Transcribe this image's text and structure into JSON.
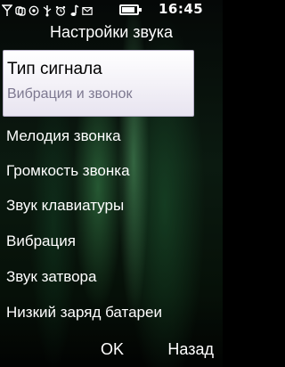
{
  "status_bar": {
    "icons": [
      "signal-icon",
      "link-icon",
      "message-icon",
      "usb-icon",
      "alarm-icon",
      "music-note-icon",
      "mail-icon"
    ],
    "time": "16:45"
  },
  "header": {
    "title": "Настройки звука"
  },
  "menu": {
    "selected": {
      "label": "Тип сигнала",
      "value": "Вибрация и звонок"
    },
    "items": [
      "Мелодия звонка",
      "Громкость звонка",
      "Звук клавиатуры",
      "Вибрация",
      "Звук затвора",
      "Низкий заряд батареи"
    ]
  },
  "softkeys": {
    "ok_label": "OK",
    "back_label": "Назад"
  },
  "colors": {
    "selection_bg": "#ffffff",
    "selection_subtext": "#7d7890",
    "background": "#000000"
  }
}
